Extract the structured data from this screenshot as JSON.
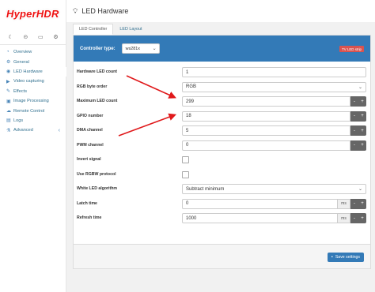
{
  "brand": {
    "logo_text": "HyperHDR"
  },
  "header": {
    "title": "LED Hardware"
  },
  "sidebar": {
    "quick_icons": [
      "moon-icon",
      "toggle-icon",
      "monitor-icon",
      "settings-icon"
    ],
    "items": [
      {
        "label": "Overview",
        "icon": "dashboard-icon"
      },
      {
        "label": "General",
        "icon": "gear-icon"
      },
      {
        "label": "LED Hardware",
        "icon": "bulb-icon"
      },
      {
        "label": "Video capturing",
        "icon": "video-icon"
      },
      {
        "label": "Effects",
        "icon": "effects-icon"
      },
      {
        "label": "Image Processing",
        "icon": "image-icon"
      },
      {
        "label": "Remote Control",
        "icon": "remote-icon"
      },
      {
        "label": "Logs",
        "icon": "logs-icon"
      },
      {
        "label": "Advanced",
        "icon": "advanced-icon"
      }
    ]
  },
  "tabs": [
    {
      "label": "LED Controller",
      "active": true
    },
    {
      "label": "LED Layout",
      "active": false
    }
  ],
  "panel": {
    "controller_label": "Controller type:",
    "controller_value": "ws281x",
    "badge": "TV LED strip",
    "fields": {
      "hardware_led_count": {
        "label": "Hardware LED count",
        "value": "1"
      },
      "rgb_byte_order": {
        "label": "RGB byte order",
        "value": "RGB"
      },
      "max_led_count": {
        "label": "Maximum LED count",
        "value": "299"
      },
      "gpio_number": {
        "label": "GPIO number",
        "value": "18"
      },
      "dma_channel": {
        "label": "DMA channel",
        "value": "5"
      },
      "pwm_channel": {
        "label": "PWM channel",
        "value": "0"
      },
      "invert_signal": {
        "label": "Invert signal"
      },
      "use_rgbw": {
        "label": "Use RGBW protocol"
      },
      "white_led_algorithm": {
        "label": "White LED algorithm",
        "value": "Subtract minimum"
      },
      "latch_time": {
        "label": "Latch time",
        "value": "0",
        "unit": "ms"
      },
      "refresh_time": {
        "label": "Refresh time",
        "value": "1000",
        "unit": "ms"
      }
    },
    "stepper": {
      "minus": "-",
      "plus": "+"
    },
    "save_label": "Save settings"
  },
  "colors": {
    "accent": "#337ab7",
    "badge": "#d9534f",
    "annotation": "#e0191b"
  }
}
